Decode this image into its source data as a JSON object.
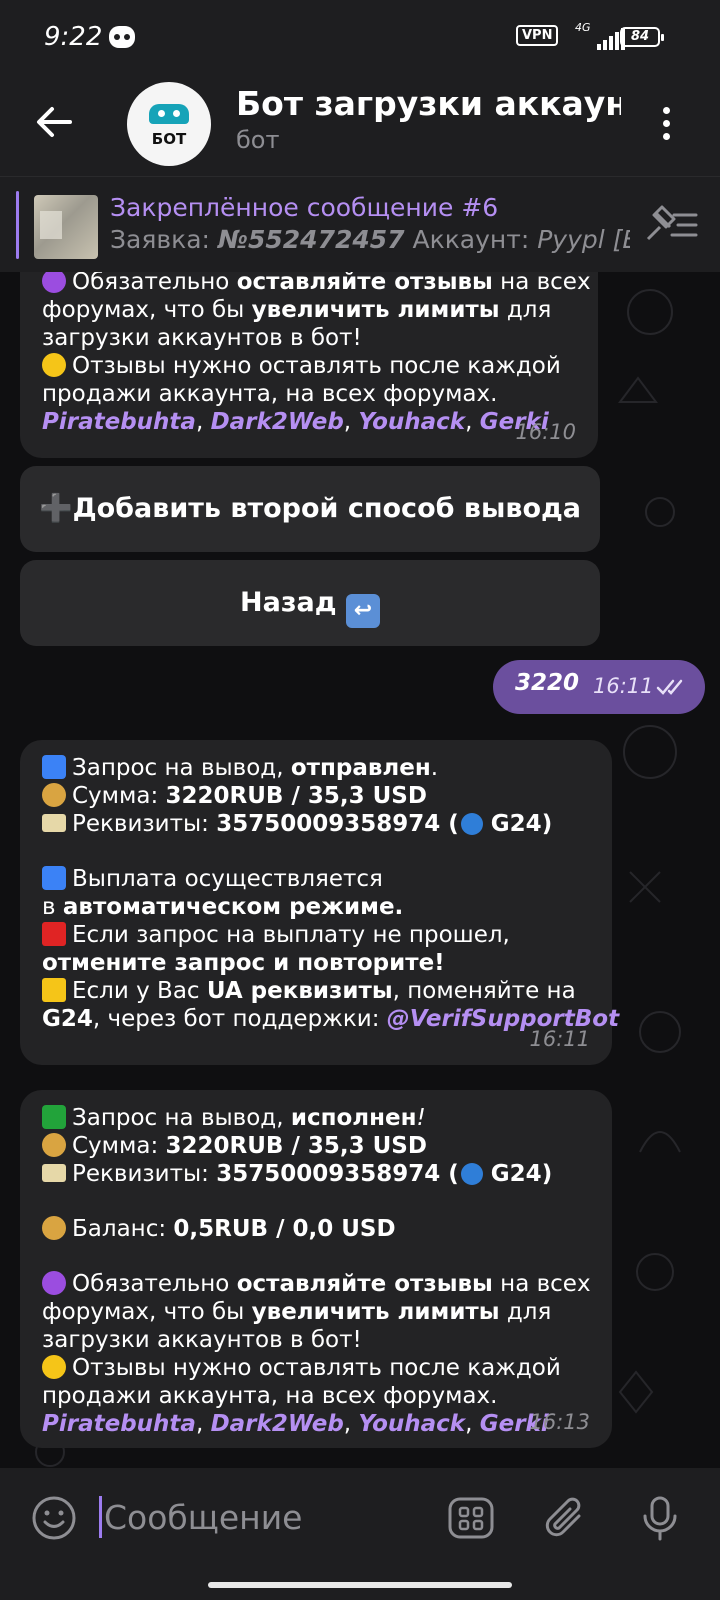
{
  "status": {
    "time": "9:22",
    "vpn": "VPN",
    "network": "4G",
    "battery": "84"
  },
  "header": {
    "title": "Бот загрузки аккаунто",
    "subtitle": "бот",
    "avatar_text": "БОТ"
  },
  "pinned": {
    "title": "Закреплённое сообщение #6",
    "sub_prefix": "Заявка: ",
    "sub_number": "№552472457",
    "sub_mid": " Аккаунт: ",
    "sub_tail": "Pyypl [E..."
  },
  "messages": {
    "m1": {
      "l1a": "Обязательно ",
      "l1b": "оставляйте отзывы",
      "l1c": " на всех",
      "l2a": "форумах, что бы ",
      "l2b": "увеличить лимиты",
      "l2c": " для",
      "l3": "загрузки аккаунтов в бот!",
      "l4": "Отзывы нужно оставлять после каждой",
      "l5": "продажи аккаунта, на всех форумах.",
      "links": [
        "Piratebuhta",
        "Dark2Web",
        "Youhack",
        "Gerki"
      ],
      "time": "16:10"
    },
    "buttons": {
      "add_method": "Добавить второй способ вывода",
      "back": "Назад"
    },
    "outgoing": {
      "text": "3220",
      "time": "16:11"
    },
    "m2": {
      "l1a": "Запрос на вывод, ",
      "l1b": "отправлен",
      "l1c": ".",
      "l2a": "Сумма: ",
      "l2b": "3220RUB  / 35,3 USD",
      "l3a": "Реквизиты: ",
      "l3b": "35750009358974 (",
      "l3c": " G24)",
      "l4": "Выплата осуществляется",
      "l5a": "в ",
      "l5b": "автоматическом режиме.",
      "l6": "Если запрос на выплату не прошел,",
      "l7": "отмените запрос и повторите!",
      "l8a": "Если у Вас ",
      "l8b": "UA реквизиты",
      "l8c": ", поменяйте на",
      "l9a": "G24",
      "l9b": ", через бот поддержки: ",
      "l9c": "@VerifSupportBot",
      "time": "16:11"
    },
    "m3": {
      "l1a": "Запрос на вывод, ",
      "l1b": "исполнен",
      "l1c": "!",
      "l2a": "Сумма: ",
      "l2b": "3220RUB  / 35,3 USD",
      "l3a": "Реквизиты: ",
      "l3b": "35750009358974 (",
      "l3c": " G24)",
      "l4a": "Баланс: ",
      "l4b": "0,5RUB  / 0,0 USD",
      "l5a": "Обязательно ",
      "l5b": "оставляйте отзывы",
      "l5c": " на всех",
      "l6a": "форумах, что бы ",
      "l6b": "увеличить лимиты",
      "l6c": " для",
      "l7": "загрузки аккаунтов в бот!",
      "l8": "Отзывы нужно оставлять после каждой",
      "l9": "продажи аккаунта, на всех форумах.",
      "links": [
        "Piratebuhta",
        "Dark2Web",
        "Youhack",
        "Gerki"
      ],
      "time": "16:13"
    }
  },
  "input": {
    "placeholder": "Сообщение"
  },
  "colors": {
    "accent": "#b58ff2",
    "outgoing_bubble": "#6b4f9e",
    "incoming_bubble": "#232325",
    "bar": "#1e1e20"
  }
}
